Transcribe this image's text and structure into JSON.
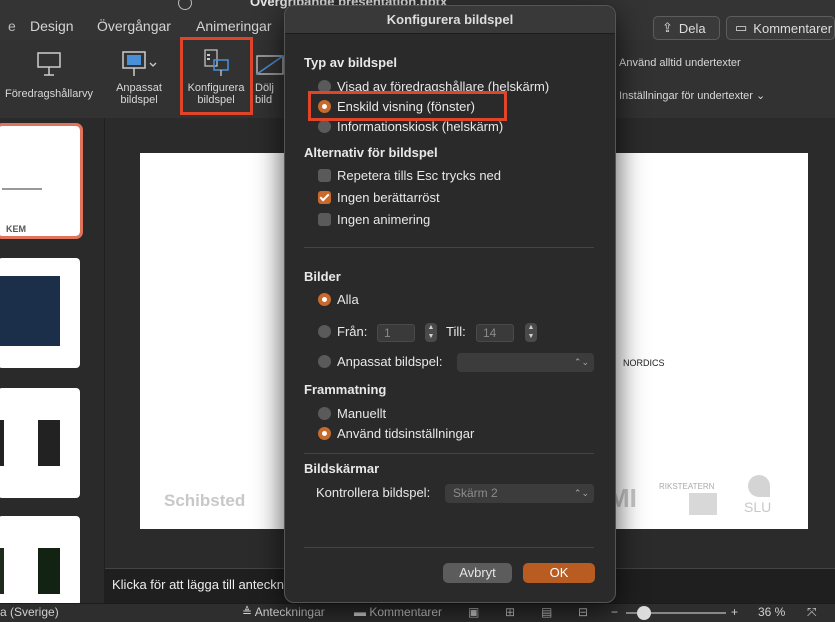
{
  "ribbon_tabs": [
    "Design",
    "Övergångar",
    "Animeringar"
  ],
  "document_title": "Övergripande presentation.pptx",
  "top_buttons": {
    "share": "Dela",
    "comments": "Kommentarer"
  },
  "ribbon": {
    "presenter_view": "Föredragshållarvy",
    "custom_show": "Anpassat bildspel",
    "configure": "Konfigurera bildspel",
    "hide_partial": "Dölj bild",
    "always_subtitles": "Använd alltid undertexter",
    "subtitle_settings": "Inställningar för undertexter"
  },
  "dialog": {
    "title": "Konfigurera bildspel",
    "type_section": "Typ av bildspel",
    "type_options": [
      {
        "label": "Visad av föredragshållare (helskärm)",
        "selected": false
      },
      {
        "label": "Enskild visning (fönster)",
        "selected": true
      },
      {
        "label": "Informationskiosk (helskärm)",
        "selected": false
      }
    ],
    "options_section": "Alternativ för bildspel",
    "checkboxes": [
      {
        "label": "Repetera tills Esc trycks ned",
        "checked": false
      },
      {
        "label": "Ingen berättarröst",
        "checked": true
      },
      {
        "label": "Ingen animering",
        "checked": false
      }
    ],
    "slides_section": "Bilder",
    "all_label": "Alla",
    "from_label": "Från:",
    "from_value": "1",
    "to_label": "Till:",
    "to_value": "14",
    "custom_label": "Anpassat bildspel:",
    "advance_section": "Frammatning",
    "manual_label": "Manuellt",
    "timings_label": "Använd tidsinställningar",
    "monitors_section": "Bildskärmar",
    "control_label": "Kontrollera bildspel:",
    "monitor_value": "Skärm 2",
    "cancel": "Avbryt",
    "ok": "OK"
  },
  "slide_text": {
    "logo_left": "Schibsted",
    "nordics": "NORDICS",
    "riksteatern": "RIKSTEATERN",
    "slu": "SLU",
    "mi": "MI",
    "kem": "KEM"
  },
  "notes_placeholder": "Klicka för att lägga till anteckningar",
  "status": {
    "language": "a (Sverige)",
    "notes": "Anteckningar",
    "comments": "Kommentarer",
    "zoom": "36 %"
  },
  "colors": {
    "accent": "#c86a2c",
    "highlight": "#e0452a"
  }
}
